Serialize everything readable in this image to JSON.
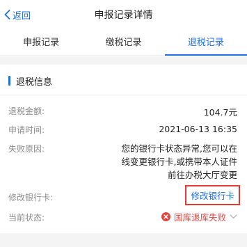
{
  "header": {
    "back_label": "返回",
    "title": "申报记录详情"
  },
  "tabs": [
    {
      "label": "申报记录",
      "active": false
    },
    {
      "label": "缴税记录",
      "active": false
    },
    {
      "label": "退税记录",
      "active": true
    }
  ],
  "section": {
    "title": "退税信息"
  },
  "fields": {
    "amount": {
      "label": "退税金额:",
      "value": "104.7元"
    },
    "apply_time": {
      "label": "申请时间:",
      "value": "2021-06-13 16:35"
    },
    "fail_reason": {
      "label": "失败原因:",
      "lines": [
        "您的银行卡状态异常,您可以在",
        "线变更银行卡,或携带本人证件",
        "前往办税大厅变更"
      ]
    },
    "modify_card": {
      "label": "修改银行卡:",
      "link": "修改银行卡"
    },
    "status": {
      "label": "当前状态:",
      "value": "国库退库失败"
    }
  },
  "colors": {
    "accent": "#1f6fe3",
    "error": "#e0463d",
    "highlight_box": "#e53935"
  }
}
